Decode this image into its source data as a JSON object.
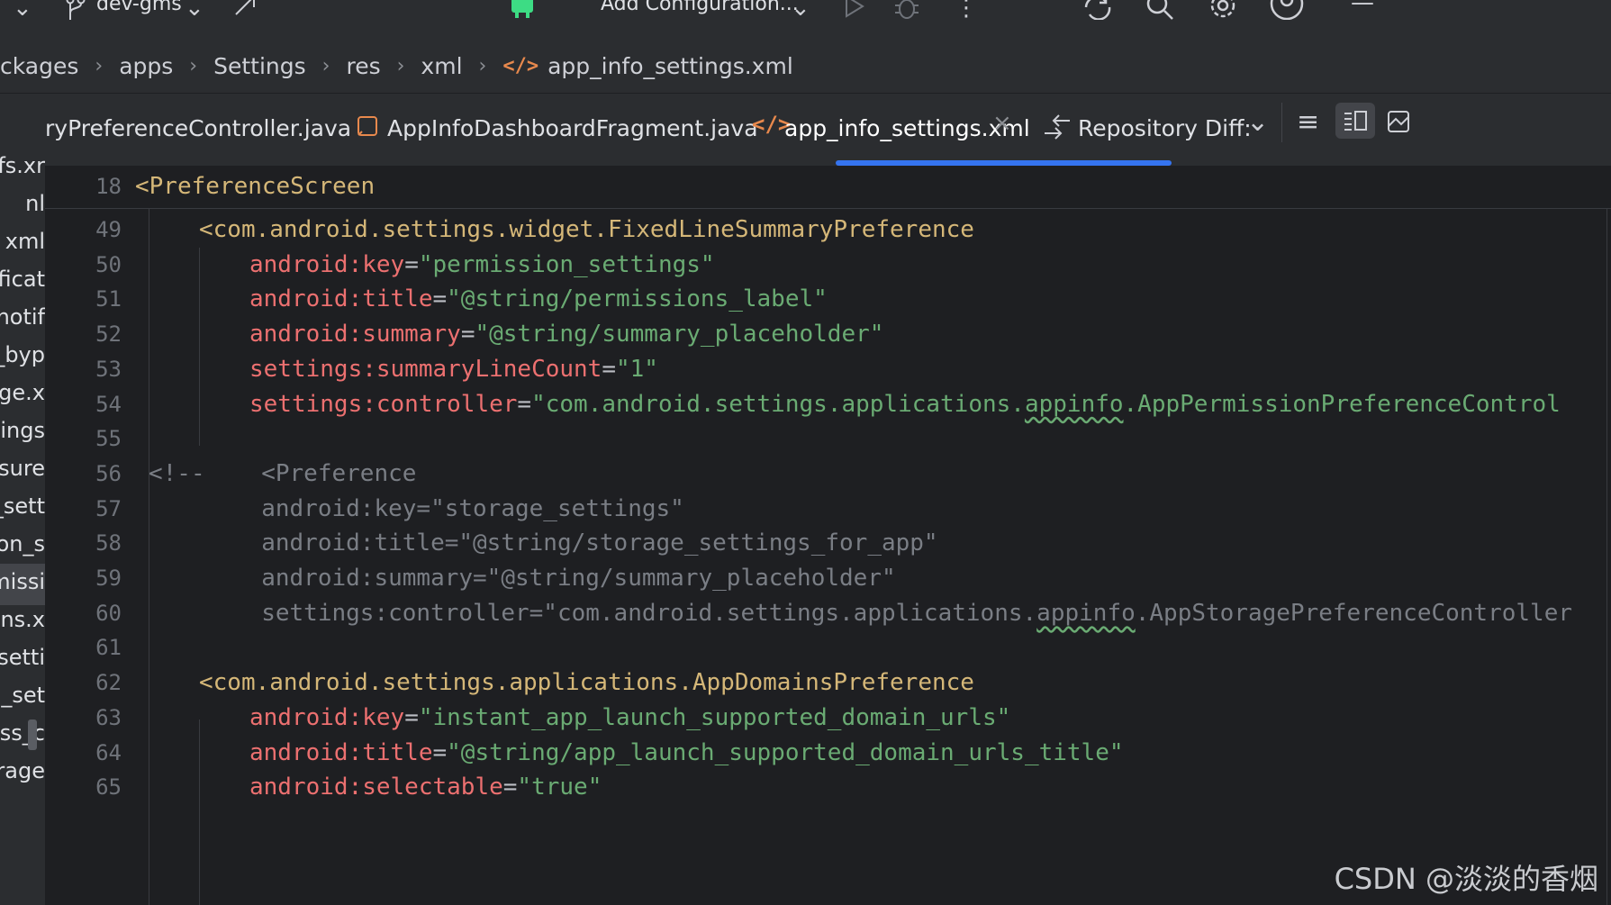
{
  "toolbar": {
    "branch": "dev-gms",
    "run_config": "Add Configuration...",
    "icons": [
      "branch-icon",
      "chevron-down-icon",
      "commit-arrow-icon",
      "android-icon",
      "run-icon",
      "debug-icon",
      "more-icon",
      "sync-icon",
      "search-icon",
      "gear-icon",
      "account-icon",
      "minimize-icon"
    ]
  },
  "breadcrumb": {
    "items": [
      "ckages",
      "apps",
      "Settings",
      "res",
      "xml",
      "app_info_settings.xml"
    ]
  },
  "project_panel": {
    "items": [
      "efs.xr",
      "nl",
      "xml",
      "ificat",
      "notif",
      "s_byp",
      "age.x",
      "tings",
      "osure",
      "_sett",
      "ion_s",
      "missi",
      "ons.x",
      "setti",
      "e_set",
      "ess_c",
      "orage"
    ],
    "selected_index": 7
  },
  "tabs": {
    "items": [
      {
        "label": "ryPreferenceController.java"
      },
      {
        "label": "AppInfoDashboardFragment.java"
      },
      {
        "label": "app_info_settings.xml",
        "active": true
      },
      {
        "label": "Repository Diff:"
      }
    ]
  },
  "editor": {
    "sticky_line": {
      "number": "18",
      "text": "<PreferenceScreen"
    },
    "lines": [
      {
        "n": "49",
        "text": "<com.android.settings.widget.FixedLineSummaryPreference"
      },
      {
        "n": "50",
        "attr": "android:key",
        "val": "\"permission_settings\""
      },
      {
        "n": "51",
        "attr": "android:title",
        "val": "\"@string/permissions_label\""
      },
      {
        "n": "52",
        "attr": "android:summary",
        "val": "\"@string/summary_placeholder\""
      },
      {
        "n": "53",
        "attr": "settings:summaryLineCount",
        "val": "\"1\""
      },
      {
        "n": "54",
        "attr": "settings:controller",
        "val_pre": "\"com.android.settings.applications.",
        "val_squig": "appinfo",
        "val_post": ".AppPermissionPreferenceControl"
      },
      {
        "n": "55",
        "text": ""
      },
      {
        "n": "56",
        "text": "<!--    <Preference"
      },
      {
        "n": "57",
        "text": "        android:key=\"storage_settings\""
      },
      {
        "n": "58",
        "text": "        android:title=\"@string/storage_settings_for_app\""
      },
      {
        "n": "59",
        "text": "        android:summary=\"@string/summary_placeholder\""
      },
      {
        "n": "60",
        "pre": "        settings:controller=\"com.android.settings.applications.",
        "squig": "appinfo",
        "post": ".AppStoragePreferenceController"
      },
      {
        "n": "61",
        "text": ""
      },
      {
        "n": "62",
        "text": "<com.android.settings.applications.AppDomainsPreference"
      },
      {
        "n": "63",
        "attr": "android:key",
        "val": "\"instant_app_launch_supported_domain_urls\""
      },
      {
        "n": "64",
        "attr": "android:title",
        "val": "\"@string/app_launch_supported_domain_urls_title\""
      },
      {
        "n": "65",
        "attr": "android:selectable",
        "val": "\"true\""
      }
    ]
  },
  "watermark": "CSDN @淡淡的香烟",
  "colors": {
    "accent": "#3574f0",
    "tag": "#d5b778",
    "attribute": "#ec7070",
    "string": "#6aab73",
    "comment": "#7a7e85"
  }
}
